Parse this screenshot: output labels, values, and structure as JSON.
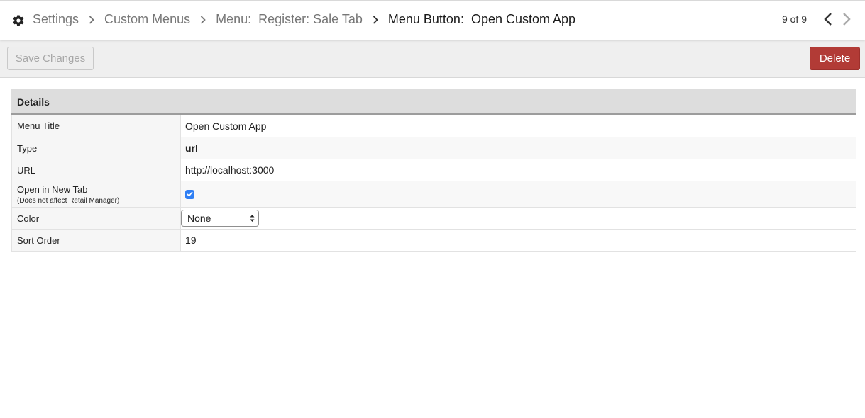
{
  "breadcrumb": {
    "items": [
      {
        "label": "Settings"
      },
      {
        "label": "Custom Menus"
      },
      {
        "label": "Menu:  Register: Sale Tab"
      }
    ],
    "current": "Menu Button:  Open Custom App"
  },
  "pager": {
    "text": "9 of 9"
  },
  "toolbar": {
    "save_label": "Save Changes",
    "delete_label": "Delete"
  },
  "details": {
    "heading": "Details",
    "rows": {
      "menu_title": {
        "label": "Menu Title",
        "value": "Open Custom App"
      },
      "type": {
        "label": "Type",
        "value": "url"
      },
      "url": {
        "label": "URL",
        "value": "http://localhost:3000"
      },
      "new_tab": {
        "label": "Open in New Tab",
        "note": "(Does not affect Retail Manager)",
        "checked": true
      },
      "color": {
        "label": "Color",
        "value": "None"
      },
      "sort_order": {
        "label": "Sort Order",
        "value": "19"
      }
    }
  },
  "colors": {
    "delete": "#b23b36",
    "checkbox": "#2f7ff4"
  }
}
